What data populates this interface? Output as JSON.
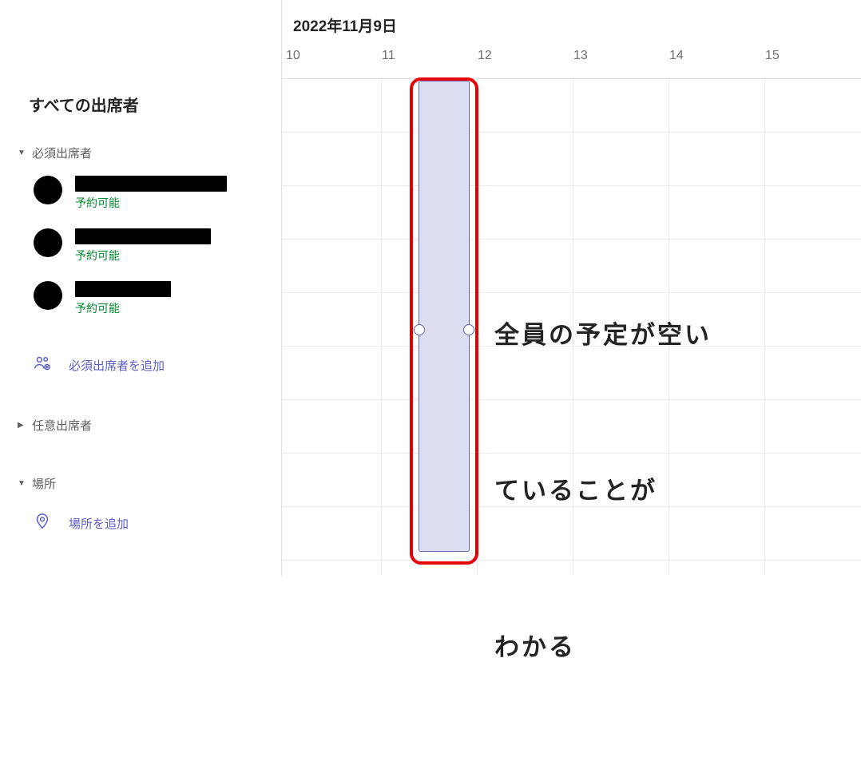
{
  "sidebar": {
    "title": "すべての出席者",
    "sections": {
      "required": {
        "label": "必須出席者",
        "expanded": true,
        "attendees": [
          {
            "status": "予約可能"
          },
          {
            "status": "予約可能"
          },
          {
            "status": "予約可能"
          }
        ],
        "add_label": "必須出席者を追加"
      },
      "optional": {
        "label": "任意出席者",
        "expanded": false
      },
      "location": {
        "label": "場所",
        "expanded": true,
        "add_label": "場所を追加"
      }
    }
  },
  "schedule": {
    "date_label": "2022年11月9日",
    "hours": [
      "10",
      "11",
      "12",
      "13",
      "14",
      "15"
    ],
    "event": {
      "start_hour": 11.3,
      "end_hour": 11.8
    }
  },
  "annotation": {
    "line1": "全員の予定が空い",
    "line2": "ていることが",
    "line3": "わかる"
  },
  "colors": {
    "accent": "#5b5fc7",
    "event_bg": "#dcdff2",
    "event_border": "#6264a7",
    "status_ok": "#008a2e",
    "highlight": "#e60000"
  }
}
